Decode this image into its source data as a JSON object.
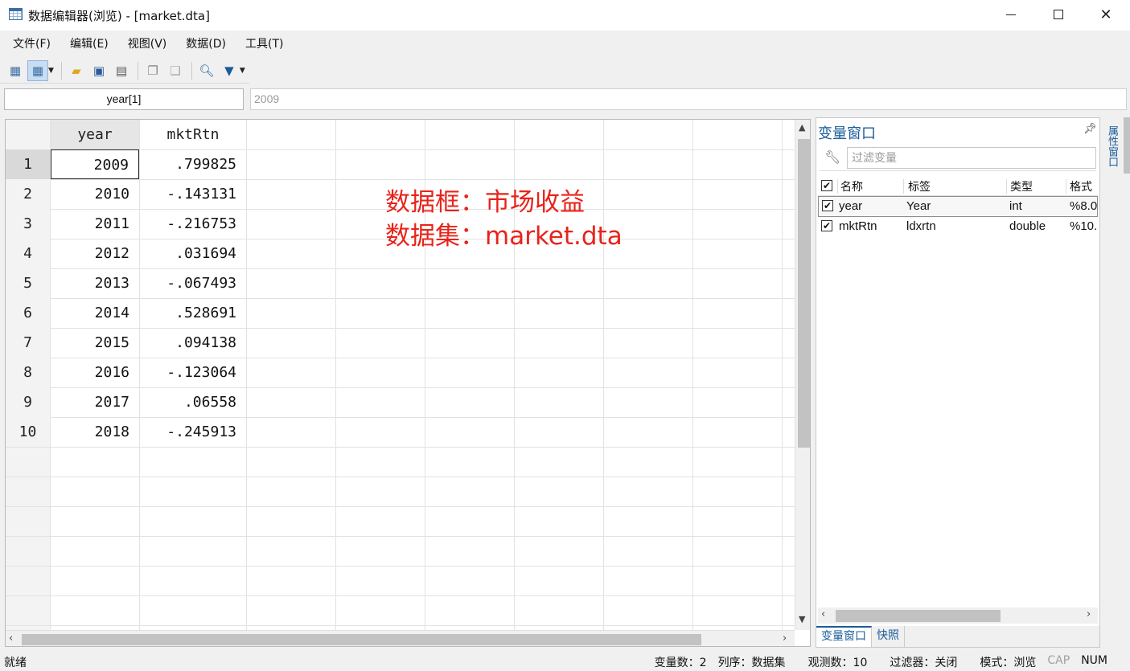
{
  "window": {
    "title": "数据编辑器(浏览) - [market.dta]"
  },
  "menu": [
    "文件(F)",
    "编辑(E)",
    "视图(V)",
    "数据(D)",
    "工具(T)"
  ],
  "editbar": {
    "cell_name": "year[1]",
    "cell_value": "2009"
  },
  "grid": {
    "columns": [
      "year",
      "mktRtn"
    ],
    "rows": [
      {
        "n": "1",
        "year": "2009",
        "mktRtn": ".799825"
      },
      {
        "n": "2",
        "year": "2010",
        "mktRtn": "-.143131"
      },
      {
        "n": "3",
        "year": "2011",
        "mktRtn": "-.216753"
      },
      {
        "n": "4",
        "year": "2012",
        "mktRtn": ".031694"
      },
      {
        "n": "5",
        "year": "2013",
        "mktRtn": "-.067493"
      },
      {
        "n": "6",
        "year": "2014",
        "mktRtn": ".528691"
      },
      {
        "n": "7",
        "year": "2015",
        "mktRtn": ".094138"
      },
      {
        "n": "8",
        "year": "2016",
        "mktRtn": "-.123064"
      },
      {
        "n": "9",
        "year": "2017",
        "mktRtn": ".06558"
      },
      {
        "n": "10",
        "year": "2018",
        "mktRtn": "-.245913"
      }
    ]
  },
  "annotation": {
    "line1": "数据框：市场收益",
    "line2": "数据集：market.dta",
    "color": "#e8231a"
  },
  "variables_panel": {
    "title": "变量窗口",
    "filter_placeholder": "过滤变量",
    "headers": {
      "name": "名称",
      "label": "标签",
      "type": "类型",
      "format": "格式"
    },
    "vars": [
      {
        "name": "year",
        "label": "Year",
        "type": "int",
        "format": "%8.0"
      },
      {
        "name": "mktRtn",
        "label": "ldxrtn",
        "type": "double",
        "format": "%10."
      }
    ],
    "tabs": [
      "变量窗口",
      "快照"
    ]
  },
  "side_tab": "属性窗口",
  "status": {
    "ready": "就绪",
    "vars": "变量数：2",
    "order": "列序：数据集",
    "obs": "观测数：10",
    "filter": "过滤器：关闭",
    "mode": "模式：浏览",
    "cap": "CAP",
    "num": "NUM"
  },
  "colors": {
    "accent": "#1a5c9a",
    "selection_header": "#e6e6e6"
  }
}
